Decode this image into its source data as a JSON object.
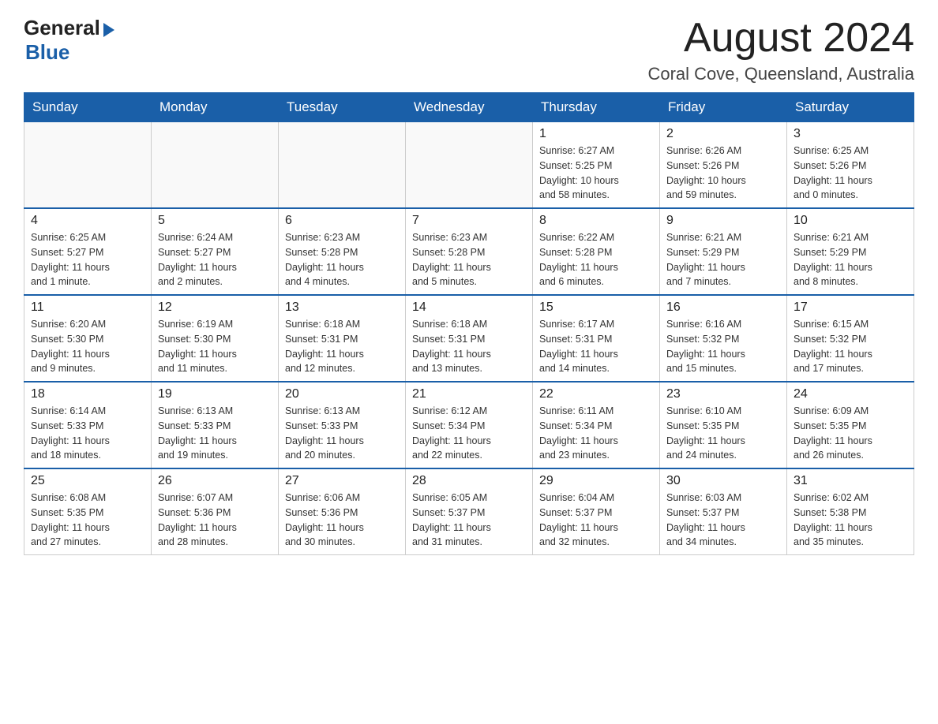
{
  "header": {
    "logo_general": "General",
    "logo_blue": "Blue",
    "month_title": "August 2024",
    "location": "Coral Cove, Queensland, Australia"
  },
  "weekdays": [
    "Sunday",
    "Monday",
    "Tuesday",
    "Wednesday",
    "Thursday",
    "Friday",
    "Saturday"
  ],
  "weeks": [
    [
      {
        "day": "",
        "info": ""
      },
      {
        "day": "",
        "info": ""
      },
      {
        "day": "",
        "info": ""
      },
      {
        "day": "",
        "info": ""
      },
      {
        "day": "1",
        "info": "Sunrise: 6:27 AM\nSunset: 5:25 PM\nDaylight: 10 hours\nand 58 minutes."
      },
      {
        "day": "2",
        "info": "Sunrise: 6:26 AM\nSunset: 5:26 PM\nDaylight: 10 hours\nand 59 minutes."
      },
      {
        "day": "3",
        "info": "Sunrise: 6:25 AM\nSunset: 5:26 PM\nDaylight: 11 hours\nand 0 minutes."
      }
    ],
    [
      {
        "day": "4",
        "info": "Sunrise: 6:25 AM\nSunset: 5:27 PM\nDaylight: 11 hours\nand 1 minute."
      },
      {
        "day": "5",
        "info": "Sunrise: 6:24 AM\nSunset: 5:27 PM\nDaylight: 11 hours\nand 2 minutes."
      },
      {
        "day": "6",
        "info": "Sunrise: 6:23 AM\nSunset: 5:28 PM\nDaylight: 11 hours\nand 4 minutes."
      },
      {
        "day": "7",
        "info": "Sunrise: 6:23 AM\nSunset: 5:28 PM\nDaylight: 11 hours\nand 5 minutes."
      },
      {
        "day": "8",
        "info": "Sunrise: 6:22 AM\nSunset: 5:28 PM\nDaylight: 11 hours\nand 6 minutes."
      },
      {
        "day": "9",
        "info": "Sunrise: 6:21 AM\nSunset: 5:29 PM\nDaylight: 11 hours\nand 7 minutes."
      },
      {
        "day": "10",
        "info": "Sunrise: 6:21 AM\nSunset: 5:29 PM\nDaylight: 11 hours\nand 8 minutes."
      }
    ],
    [
      {
        "day": "11",
        "info": "Sunrise: 6:20 AM\nSunset: 5:30 PM\nDaylight: 11 hours\nand 9 minutes."
      },
      {
        "day": "12",
        "info": "Sunrise: 6:19 AM\nSunset: 5:30 PM\nDaylight: 11 hours\nand 11 minutes."
      },
      {
        "day": "13",
        "info": "Sunrise: 6:18 AM\nSunset: 5:31 PM\nDaylight: 11 hours\nand 12 minutes."
      },
      {
        "day": "14",
        "info": "Sunrise: 6:18 AM\nSunset: 5:31 PM\nDaylight: 11 hours\nand 13 minutes."
      },
      {
        "day": "15",
        "info": "Sunrise: 6:17 AM\nSunset: 5:31 PM\nDaylight: 11 hours\nand 14 minutes."
      },
      {
        "day": "16",
        "info": "Sunrise: 6:16 AM\nSunset: 5:32 PM\nDaylight: 11 hours\nand 15 minutes."
      },
      {
        "day": "17",
        "info": "Sunrise: 6:15 AM\nSunset: 5:32 PM\nDaylight: 11 hours\nand 17 minutes."
      }
    ],
    [
      {
        "day": "18",
        "info": "Sunrise: 6:14 AM\nSunset: 5:33 PM\nDaylight: 11 hours\nand 18 minutes."
      },
      {
        "day": "19",
        "info": "Sunrise: 6:13 AM\nSunset: 5:33 PM\nDaylight: 11 hours\nand 19 minutes."
      },
      {
        "day": "20",
        "info": "Sunrise: 6:13 AM\nSunset: 5:33 PM\nDaylight: 11 hours\nand 20 minutes."
      },
      {
        "day": "21",
        "info": "Sunrise: 6:12 AM\nSunset: 5:34 PM\nDaylight: 11 hours\nand 22 minutes."
      },
      {
        "day": "22",
        "info": "Sunrise: 6:11 AM\nSunset: 5:34 PM\nDaylight: 11 hours\nand 23 minutes."
      },
      {
        "day": "23",
        "info": "Sunrise: 6:10 AM\nSunset: 5:35 PM\nDaylight: 11 hours\nand 24 minutes."
      },
      {
        "day": "24",
        "info": "Sunrise: 6:09 AM\nSunset: 5:35 PM\nDaylight: 11 hours\nand 26 minutes."
      }
    ],
    [
      {
        "day": "25",
        "info": "Sunrise: 6:08 AM\nSunset: 5:35 PM\nDaylight: 11 hours\nand 27 minutes."
      },
      {
        "day": "26",
        "info": "Sunrise: 6:07 AM\nSunset: 5:36 PM\nDaylight: 11 hours\nand 28 minutes."
      },
      {
        "day": "27",
        "info": "Sunrise: 6:06 AM\nSunset: 5:36 PM\nDaylight: 11 hours\nand 30 minutes."
      },
      {
        "day": "28",
        "info": "Sunrise: 6:05 AM\nSunset: 5:37 PM\nDaylight: 11 hours\nand 31 minutes."
      },
      {
        "day": "29",
        "info": "Sunrise: 6:04 AM\nSunset: 5:37 PM\nDaylight: 11 hours\nand 32 minutes."
      },
      {
        "day": "30",
        "info": "Sunrise: 6:03 AM\nSunset: 5:37 PM\nDaylight: 11 hours\nand 34 minutes."
      },
      {
        "day": "31",
        "info": "Sunrise: 6:02 AM\nSunset: 5:38 PM\nDaylight: 11 hours\nand 35 minutes."
      }
    ]
  ]
}
